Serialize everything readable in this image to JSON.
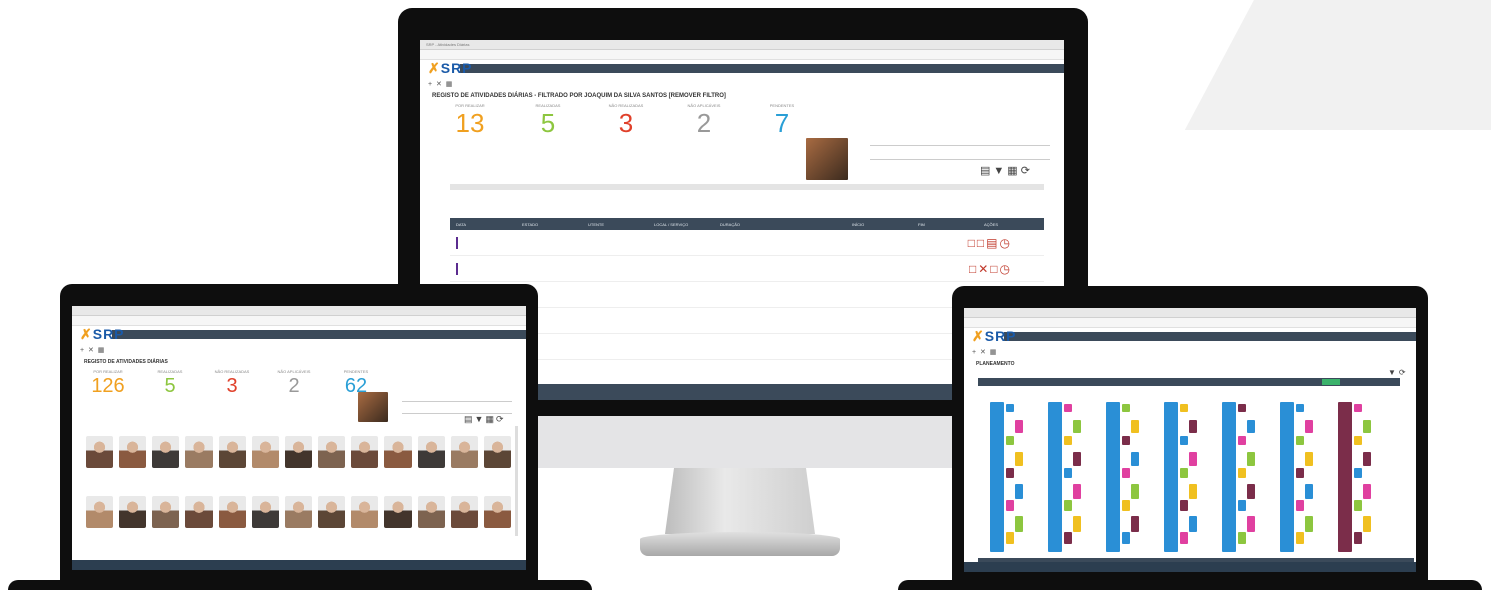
{
  "monitor": {
    "browser_tab": "SRP - Atividades Diárias",
    "app_title": "SRP",
    "section_title": "REGISTO DE ATIVIDADES DIÁRIAS - FILTRADO POR JOAQUIM DA SILVA SANTOS [REMOVER FILTRO]",
    "stats": [
      {
        "label": "POR REALIZAR",
        "value": "13",
        "color": "#f0a020"
      },
      {
        "label": "REALIZADAS",
        "value": "5",
        "color": "#8dc63f"
      },
      {
        "label": "NÃO REALIZADAS",
        "value": "3",
        "color": "#e0402a"
      },
      {
        "label": "NÃO APLICÁVEIS",
        "value": "2",
        "color": "#999999"
      },
      {
        "label": "PENDENTES",
        "value": "7",
        "color": "#2a9fd6"
      }
    ],
    "table_headers": [
      "DATA",
      "ESTADO",
      "UTENTE",
      "LOCAL / SERVIÇO",
      "DURAÇÃO",
      "",
      "INÍCIO",
      "FIM",
      "AÇÕES"
    ]
  },
  "laptop_left": {
    "app_title": "SRP",
    "section_title": "REGISTO DE ATIVIDADES DIÁRIAS",
    "stats": [
      {
        "label": "POR REALIZAR",
        "value": "126",
        "color": "#f0a020"
      },
      {
        "label": "REALIZADAS",
        "value": "5",
        "color": "#8dc63f"
      },
      {
        "label": "NÃO REALIZADAS",
        "value": "3",
        "color": "#e0402a"
      },
      {
        "label": "NÃO APLICÁVEIS",
        "value": "2",
        "color": "#999999"
      },
      {
        "label": "PENDENTES",
        "value": "62",
        "color": "#2a9fd6"
      }
    ]
  },
  "laptop_right": {
    "app_title": "SRP",
    "section_title": "PLANEAMENTO"
  },
  "colors": {
    "nav": "#3b4a5a",
    "brand": "#1a5aa8",
    "accent": "#f0a020"
  }
}
